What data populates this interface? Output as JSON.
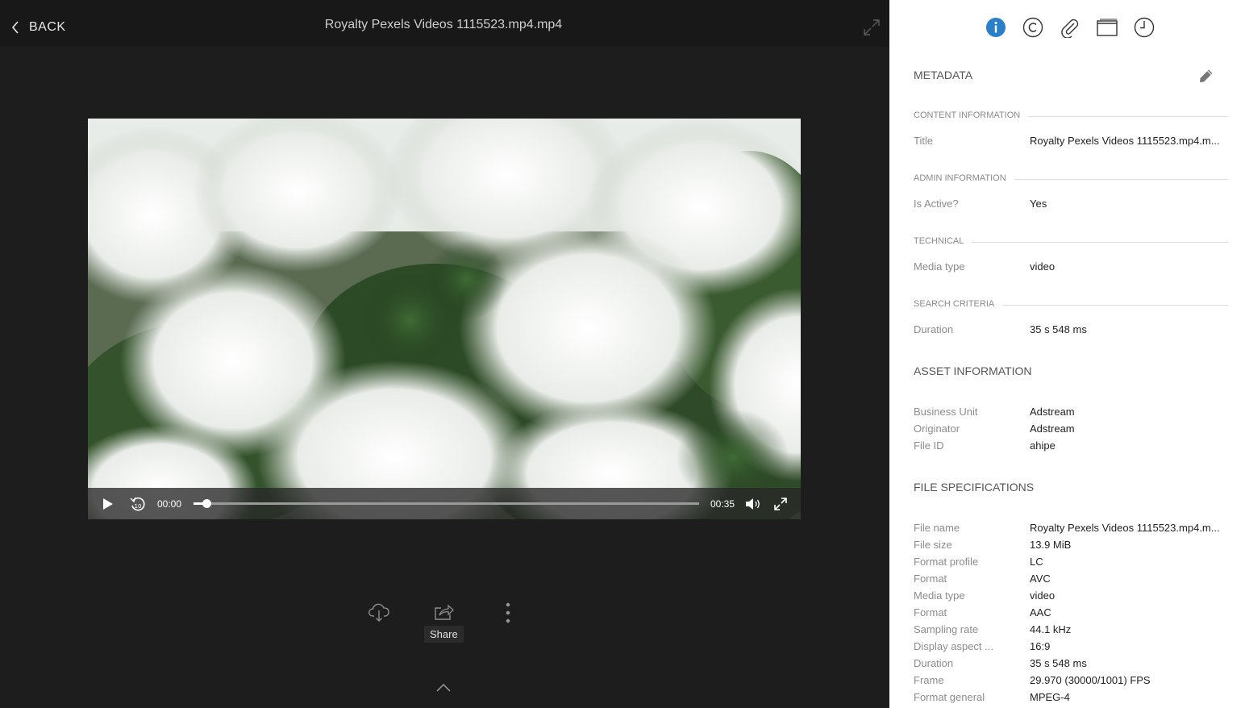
{
  "viewer": {
    "back_label": "BACK",
    "file_title": "Royalty Pexels Videos 1115523.mp4.mp4",
    "player": {
      "current_time": "00:00",
      "total_time": "00:35",
      "progress_fraction": 0.025
    },
    "actions": {
      "download_icon": "cloud-download-icon",
      "share_label": "Share",
      "more_icon": "more-vertical-icon"
    }
  },
  "panel": {
    "tabs": [
      {
        "icon": "info-icon",
        "active": true
      },
      {
        "icon": "copyright-icon",
        "active": false
      },
      {
        "icon": "paperclip-icon",
        "active": false
      },
      {
        "icon": "window-icon",
        "active": false
      },
      {
        "icon": "clock-icon",
        "active": false
      }
    ],
    "metadata_heading": "METADATA",
    "content_information": {
      "label": "CONTENT INFORMATION",
      "rows": [
        {
          "key": "Title",
          "value": "Royalty Pexels Videos 1115523.mp4.m..."
        }
      ]
    },
    "admin_information": {
      "label": "ADMIN INFORMATION",
      "rows": [
        {
          "key": "Is Active?",
          "value": "Yes"
        }
      ]
    },
    "technical": {
      "label": "TECHNICAL",
      "rows": [
        {
          "key": "Media type",
          "value": "video"
        }
      ]
    },
    "search_criteria": {
      "label": "SEARCH CRITERIA",
      "rows": [
        {
          "key": "Duration",
          "value": "35 s 548 ms"
        }
      ]
    },
    "asset_information": {
      "label": "ASSET INFORMATION",
      "rows": [
        {
          "key": "Business Unit",
          "value": "Adstream"
        },
        {
          "key": "Originator",
          "value": "Adstream"
        },
        {
          "key": "File ID",
          "value": "ahipe"
        }
      ]
    },
    "file_specifications": {
      "label": "FILE SPECIFICATIONS",
      "rows": [
        {
          "key": "File name",
          "value": "Royalty Pexels Videos 1115523.mp4.m..."
        },
        {
          "key": "File size",
          "value": "13.9 MiB"
        },
        {
          "key": "Format profile",
          "value": "LC"
        },
        {
          "key": "Format",
          "value": "AVC"
        },
        {
          "key": "Media type",
          "value": "video"
        },
        {
          "key": "Format",
          "value": "AAC"
        },
        {
          "key": "Sampling rate",
          "value": "44.1 kHz"
        },
        {
          "key": "Display aspect ...",
          "value": "16:9"
        },
        {
          "key": "Duration",
          "value": "35 s 548 ms"
        },
        {
          "key": "Frame",
          "value": "29.970 (30000/1001) FPS"
        },
        {
          "key": "Format general",
          "value": "MPEG-4"
        }
      ]
    },
    "colors": {
      "accent": "#2a7fc9",
      "panel_bg": "#ffffff",
      "viewer_bg": "#1d1d1d"
    }
  }
}
